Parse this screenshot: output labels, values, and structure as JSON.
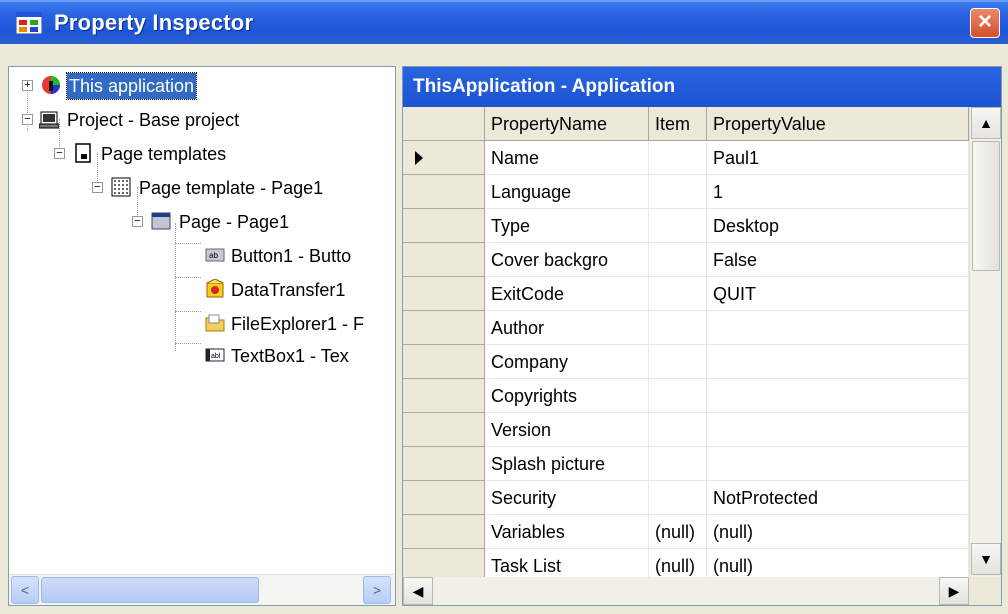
{
  "window": {
    "title": "Property Inspector",
    "close_glyph": "×"
  },
  "tree": {
    "nodes": [
      {
        "label": "This application",
        "icon": "application-icon",
        "expander": "+"
      },
      {
        "label": "Project - Base project",
        "icon": "project-icon",
        "expander": "−"
      },
      {
        "label": "Page templates",
        "icon": "page-templates-icon",
        "expander": "−"
      },
      {
        "label": "Page template - Page1",
        "icon": "page-template-icon",
        "expander": "−"
      },
      {
        "label": "Page - Page1",
        "icon": "page-icon",
        "expander": "−"
      },
      {
        "label": "Button1 - Butto",
        "icon": "button-control-icon"
      },
      {
        "label": "DataTransfer1",
        "icon": "data-transfer-icon"
      },
      {
        "label": "FileExplorer1 - F",
        "icon": "file-explorer-icon"
      },
      {
        "label": "TextBox1 - Tex",
        "icon": "textbox-control-icon"
      }
    ]
  },
  "grid": {
    "caption": "ThisApplication - Application",
    "columns": [
      "PropertyName",
      "Item",
      "PropertyValue"
    ],
    "rows": [
      {
        "name": "Name",
        "item": "",
        "value": "Paul1",
        "current": true
      },
      {
        "name": "Language",
        "item": "",
        "value": "1"
      },
      {
        "name": "Type",
        "item": "",
        "value": "Desktop"
      },
      {
        "name": "Cover backgro",
        "item": "",
        "value": "False"
      },
      {
        "name": "ExitCode",
        "item": "",
        "value": "QUIT"
      },
      {
        "name": "Author",
        "item": "",
        "value": ""
      },
      {
        "name": "Company",
        "item": "",
        "value": ""
      },
      {
        "name": "Copyrights",
        "item": "",
        "value": ""
      },
      {
        "name": "Version",
        "item": "",
        "value": ""
      },
      {
        "name": "Splash picture",
        "item": "",
        "value": ""
      },
      {
        "name": "Security",
        "item": "",
        "value": "NotProtected"
      },
      {
        "name": "Variables",
        "item": "(null)",
        "value": "(null)"
      },
      {
        "name": "Task List",
        "item": "(null)",
        "value": "(null)"
      }
    ]
  },
  "scroll": {
    "up": "▲",
    "down": "▼",
    "left": "◀",
    "right": "▶",
    "left_small": "<",
    "right_small": ">"
  }
}
